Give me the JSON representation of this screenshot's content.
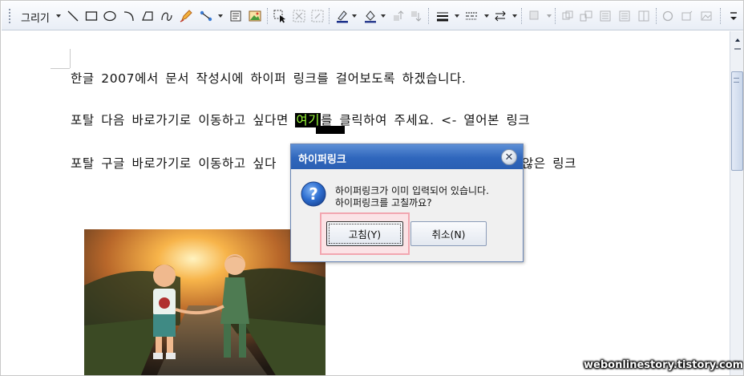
{
  "toolbar": {
    "draw_label": "그리기",
    "icons": [
      "line-icon",
      "rectangle-icon",
      "ellipse-icon",
      "arc-icon",
      "polygon-icon",
      "curve-icon",
      "pencil-icon",
      "connector-icon",
      "textbox-icon",
      "image-icon",
      "select-object-icon",
      "group-icon",
      "ungroup-icon",
      "line-color-icon",
      "fill-color-icon",
      "bring-forward-icon",
      "send-backward-icon",
      "line-style-icon",
      "line-dash-icon",
      "arrow-style-icon",
      "shadow-icon",
      "align-icon",
      "distribute-icon",
      "size-icon",
      "rotate-icon",
      "flip-icon",
      "more-icon"
    ]
  },
  "document": {
    "line1": "한글 2007에서 문서 작성시에 하이퍼 링크를 걸어보도록 하겠습니다.",
    "line2_before": "포탈 다음 바로가기로 이동하고 싶다면 ",
    "line2_link": "여기",
    "line2_after": "를 클릭하여 주세요. <- 열어본 링크",
    "line3_before": "포탈 구글 바로가기로 이동하고 싶다",
    "line3_after": "않은 링크"
  },
  "dialog": {
    "title": "하이퍼링크",
    "message_line1": "하이퍼링크가 이미 입력되어 있습니다.",
    "message_line2": "하이퍼링크를 고칠까요?",
    "ok_label": "고침(Y)",
    "cancel_label": "취소(N)"
  },
  "watermark": "webonlinestory.tistory.com",
  "colors": {
    "title_bar": "#2f66bc",
    "highlight_border": "#f2a6b0",
    "link_highlight_bg": "#000000",
    "link_highlight_fg": "#9cff3a"
  }
}
